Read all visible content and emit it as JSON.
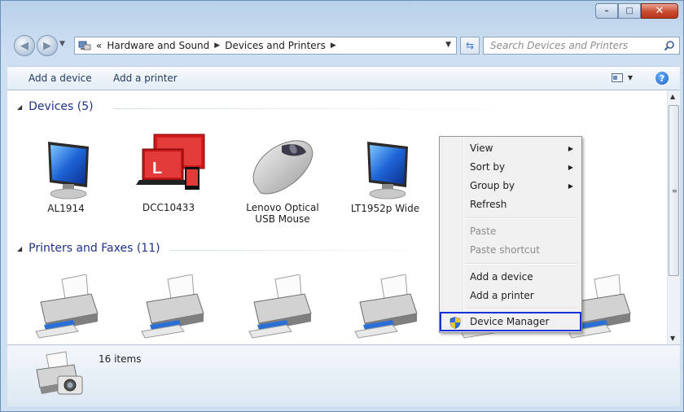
{
  "window": {
    "minimize_glyph": "–",
    "maximize_glyph": "□",
    "close_glyph": "✕"
  },
  "nav": {
    "back_glyph": "◀",
    "forward_glyph": "▶",
    "breadcrumb_prefix": "«",
    "breadcrumbs": [
      "Hardware and Sound",
      "Devices and Printers"
    ],
    "crumb_separator": "▶",
    "search_placeholder": "Search Devices and Printers"
  },
  "toolbar": {
    "add_device": "Add a device",
    "add_printer": "Add a printer",
    "help_glyph": "?"
  },
  "groups": {
    "devices": {
      "title": "Devices (5)",
      "expander": "◢"
    },
    "printers": {
      "title": "Printers and Faxes (11)",
      "expander": "◢"
    }
  },
  "devices": [
    {
      "label": "AL1914",
      "icon": "monitor-icon"
    },
    {
      "label": "DCC10433",
      "icon": "laptop-phone-icon"
    },
    {
      "label": "Lenovo Optical USB Mouse",
      "icon": "mouse-icon"
    },
    {
      "label": "LT1952p Wide",
      "icon": "monitor-icon"
    }
  ],
  "printers": [
    {
      "icon": "printer-icon"
    },
    {
      "icon": "printer-icon"
    },
    {
      "icon": "printer-icon"
    },
    {
      "icon": "printer-icon"
    },
    {
      "icon": "printer-icon"
    },
    {
      "icon": "printer-icon"
    }
  ],
  "context_menu": {
    "view": "View",
    "sort_by": "Sort by",
    "group_by": "Group by",
    "refresh": "Refresh",
    "paste": "Paste",
    "paste_shortcut": "Paste shortcut",
    "add_device": "Add a device",
    "add_printer": "Add a printer",
    "device_manager": "Device Manager",
    "submenu_arrow": "▶"
  },
  "details": {
    "item_count": "16 items"
  },
  "colors": {
    "highlight_border": "#1432d6",
    "group_header_text": "#1e3287",
    "printer_paper_accent": "#2a6fd6"
  }
}
